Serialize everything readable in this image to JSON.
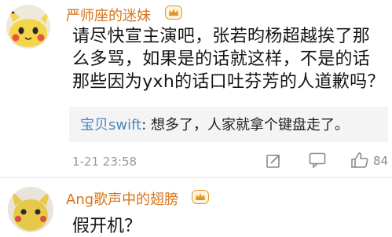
{
  "comments": [
    {
      "username": "严师座的迷妹",
      "avatar": "pikachu-avatar",
      "badge": "crown-badge-icon",
      "lines": [
        "请尽快宣主演吧，张若昀杨超越挨了那",
        "么多骂，如果是的话就这样，不是的话",
        "那些因为yxh的话口吐芬芳的人道歉吗？"
      ],
      "reply": {
        "name": "宝贝swift",
        "content": ": 想多了，人家就拿个键盘走了。"
      },
      "timestamp": "1-21 23:58",
      "like_count": "84"
    },
    {
      "username": "Ang歌声中的翅膀",
      "avatar": "pikachu-avatar",
      "badge": "crown-badge-icon",
      "text": "假开机？"
    }
  ],
  "colors": {
    "username": "#d4761a",
    "reply_name": "#4b87bd",
    "timestamp": "#9a9a9a",
    "badge": "#e0962b"
  }
}
